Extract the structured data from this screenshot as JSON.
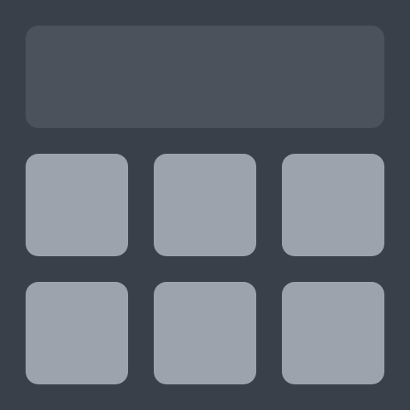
{
  "colors": {
    "background": "#394049",
    "display": "#4b525b",
    "key": "#9ca3ac"
  },
  "display": {
    "value": ""
  },
  "keypad": {
    "keys": [
      {
        "label": ""
      },
      {
        "label": ""
      },
      {
        "label": ""
      },
      {
        "label": ""
      },
      {
        "label": ""
      },
      {
        "label": ""
      }
    ]
  }
}
